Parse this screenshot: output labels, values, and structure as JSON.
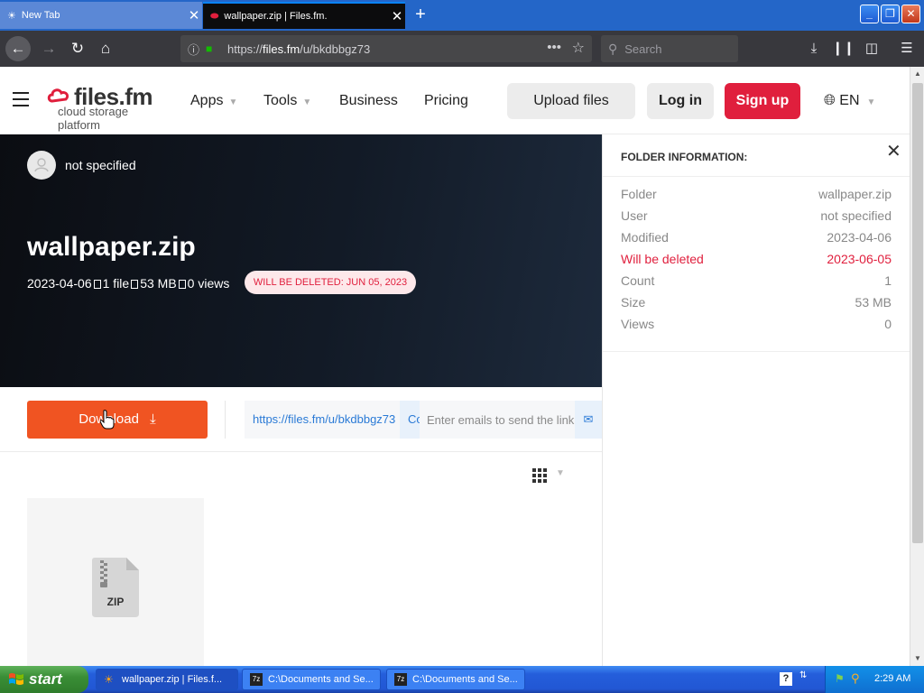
{
  "browser": {
    "tabs": [
      {
        "title": "New Tab",
        "active": false
      },
      {
        "title": "wallpaper.zip | Files.fm.",
        "active": true
      }
    ],
    "url": {
      "prefix": "https://",
      "host": "files.fm",
      "path": "/u/bkdbbgz73"
    },
    "search_placeholder": "Search"
  },
  "header": {
    "logo_name": "files.fm",
    "logo_tagline": "cloud storage platform",
    "menu": {
      "apps": "Apps",
      "tools": "Tools",
      "business": "Business",
      "pricing": "Pricing"
    },
    "upload_label": "Upload files",
    "login_label": "Log in",
    "signup_label": "Sign up",
    "language": "EN"
  },
  "hero": {
    "owner": "not specified",
    "title": "wallpaper.zip",
    "meta": {
      "date": "2023-04-06",
      "files": "1 file",
      "size": "53 MB",
      "views": "0 views"
    },
    "delete_badge": "WILL BE DELETED: JUN 05, 2023"
  },
  "actions": {
    "download_label": "Download",
    "share_link": "https://files.fm/u/bkdbbgz73",
    "copy_label": "Copy",
    "email_placeholder": "Enter emails to send the link"
  },
  "files": [
    {
      "type_label": "ZIP"
    }
  ],
  "folder_info": {
    "title": "FOLDER INFORMATION:",
    "rows": [
      {
        "label": "Folder",
        "value": "wallpaper.zip",
        "warn": false
      },
      {
        "label": "User",
        "value": "not specified",
        "warn": false
      },
      {
        "label": "Modified",
        "value": "2023-04-06",
        "warn": false
      },
      {
        "label": "Will be deleted",
        "value": "2023-06-05",
        "warn": true
      },
      {
        "label": "Count",
        "value": "1",
        "warn": false
      },
      {
        "label": "Size",
        "value": "53 MB",
        "warn": false
      },
      {
        "label": "Views",
        "value": "0",
        "warn": false
      }
    ]
  },
  "taskbar": {
    "start_label": "start",
    "items": [
      {
        "label": "wallpaper.zip | Files.f..."
      },
      {
        "label": "C:\\Documents and Se..."
      },
      {
        "label": "C:\\Documents and Se..."
      }
    ],
    "clock": "2:29 AM"
  },
  "colors": {
    "brand_red": "#e01f3d",
    "download_orange": "#f05422",
    "link_blue": "#2a7ad6",
    "xp_blue": "#245edb"
  }
}
